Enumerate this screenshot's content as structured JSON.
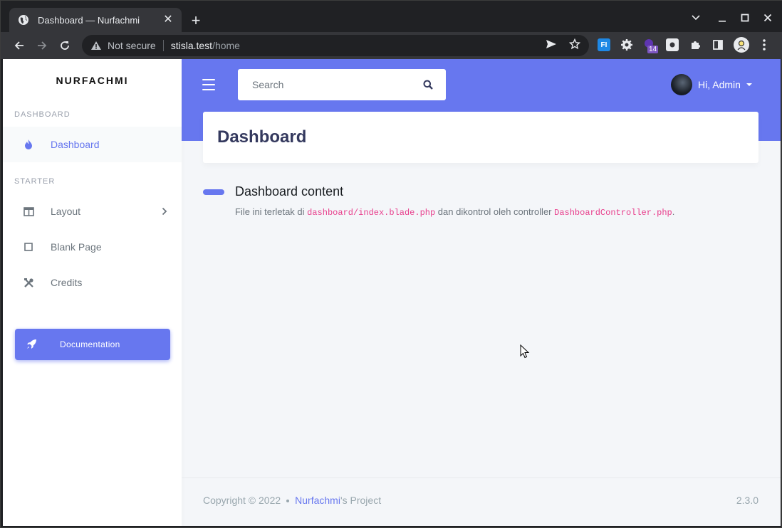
{
  "browser": {
    "tab_title": "Dashboard — Nurfachmi",
    "tab_close": "✕",
    "newtab": "+",
    "not_secure": "Not secure",
    "url_host": "stisla.test",
    "url_path": "/home",
    "extension_badge": "14",
    "extension_fi": "FI"
  },
  "sidebar": {
    "brand": "NURFACHMI",
    "header_dashboard": "DASHBOARD",
    "header_starter": "STARTER",
    "items": [
      {
        "label": "Dashboard",
        "icon": "fire-icon"
      },
      {
        "label": "Layout",
        "icon": "columns-icon"
      },
      {
        "label": "Blank Page",
        "icon": "square-icon"
      },
      {
        "label": "Credits",
        "icon": "tools-icon"
      }
    ],
    "documentation": "Documentation"
  },
  "navbar": {
    "search_placeholder": "Search",
    "user_name": "Hi, Admin"
  },
  "main": {
    "page_title": "Dashboard",
    "content_title": "Dashboard content",
    "lead_prefix": "File ini terletak di ",
    "lead_code1": "dashboard/index.blade.php",
    "lead_middle": " dan dikontrol oleh controller ",
    "lead_code2": "DashboardController.php",
    "lead_suffix": "."
  },
  "footer": {
    "copyright": "Copyright © 2022",
    "brand": "Nurfachmi",
    "project_suffix": "'s Project",
    "version": "2.3.0"
  },
  "colors": {
    "primary": "#6777ef",
    "code": "#e83e8c"
  }
}
